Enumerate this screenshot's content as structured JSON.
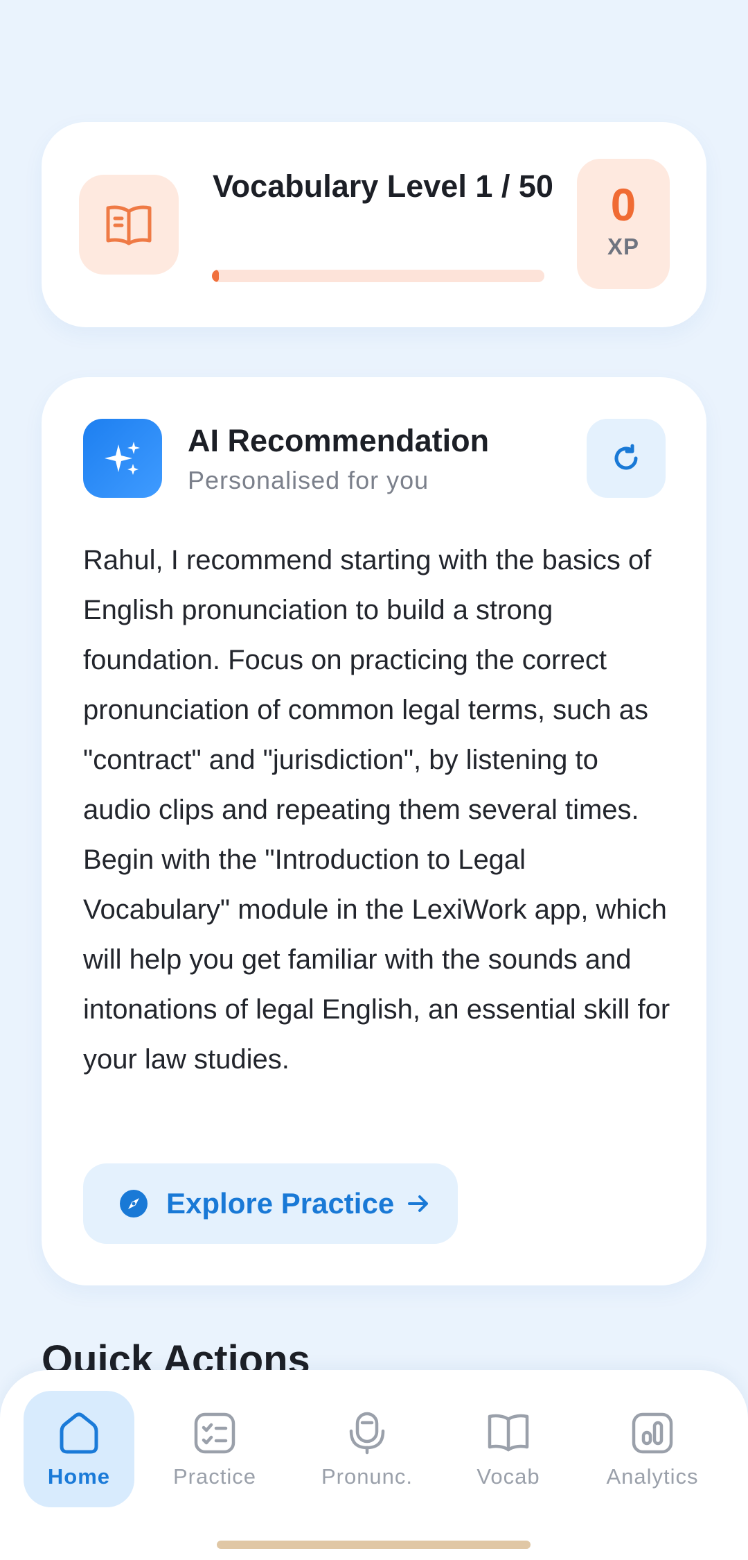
{
  "level_card": {
    "title": "Vocabulary Level 1 / 50",
    "icon": "book-icon",
    "progress": 0.02,
    "xp_value": "0",
    "xp_label": "XP",
    "accent": "#f06b33"
  },
  "ai_card": {
    "icon": "sparkles-icon",
    "title": "AI Recommendation",
    "subtitle": "Personalised for you",
    "refresh_icon": "refresh-icon",
    "body": "Rahul, I recommend starting with the basics of English pronunciation to build a strong foundation. Focus on practicing the correct pronunciation of common legal terms, such as \"contract\" and \"jurisdiction\", by listening to audio clips and repeating them several times. Begin with the \"Introduction to Legal Vocabulary\" module in the LexiWork app, which will help you get familiar with the sounds and intonations of legal English, an essential skill for your law studies.",
    "button_label": "Explore Practice",
    "button_icon": "compass-icon",
    "accent": "#1979d6"
  },
  "quick_actions": {
    "heading": "Quick Actions"
  },
  "bottom_nav": {
    "items": [
      {
        "label": "Home",
        "icon": "home-icon",
        "active": true
      },
      {
        "label": "Practice",
        "icon": "checklist-icon",
        "active": false
      },
      {
        "label": "Pronunc.",
        "icon": "microphone-icon",
        "active": false
      },
      {
        "label": "Vocab",
        "icon": "book-open-icon",
        "active": false
      },
      {
        "label": "Analytics",
        "icon": "bar-chart-icon",
        "active": false
      }
    ]
  }
}
